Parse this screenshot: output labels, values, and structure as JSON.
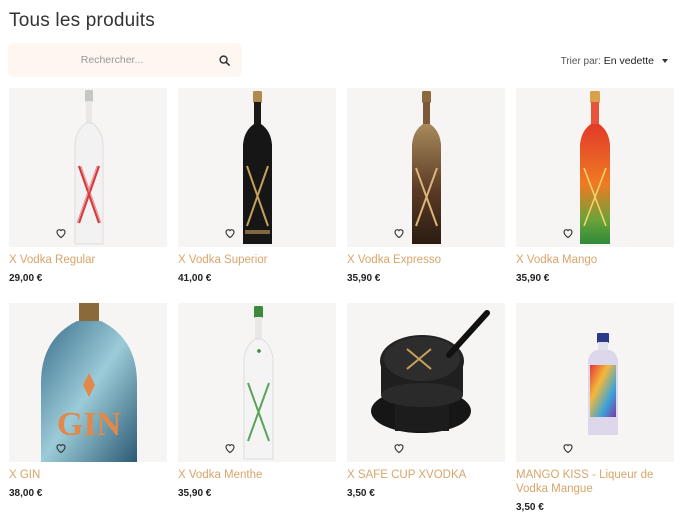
{
  "page": {
    "title": "Tous les produits"
  },
  "search": {
    "placeholder": "Rechercher..."
  },
  "sort": {
    "label": "Trier par:",
    "value": "En vedette"
  },
  "products": [
    {
      "name": "X Vodka Regular",
      "price": "29,00 €",
      "image": "white-bottle-red-x"
    },
    {
      "name": "X Vodka Superior",
      "price": "41,00 €",
      "image": "black-bottle-gold-x"
    },
    {
      "name": "X Vodka Expresso",
      "price": "35,90 €",
      "image": "brown-bottle-gold-x"
    },
    {
      "name": "X Vodka Mango",
      "price": "35,90 €",
      "image": "orange-green-bottle"
    },
    {
      "name": "X GIN",
      "price": "38,00 €",
      "image": "blue-gin-bottle"
    },
    {
      "name": "X Vodka Menthe",
      "price": "35,90 €",
      "image": "white-bottle-green-x"
    },
    {
      "name": "X SAFE CUP XVODKA",
      "price": "3,50 €",
      "image": "black-cup-lid"
    },
    {
      "name": "MANGO KISS - Liqueur de Vodka Mangue",
      "price": "3,50 €",
      "image": "mini-bottle-colorful"
    }
  ]
}
